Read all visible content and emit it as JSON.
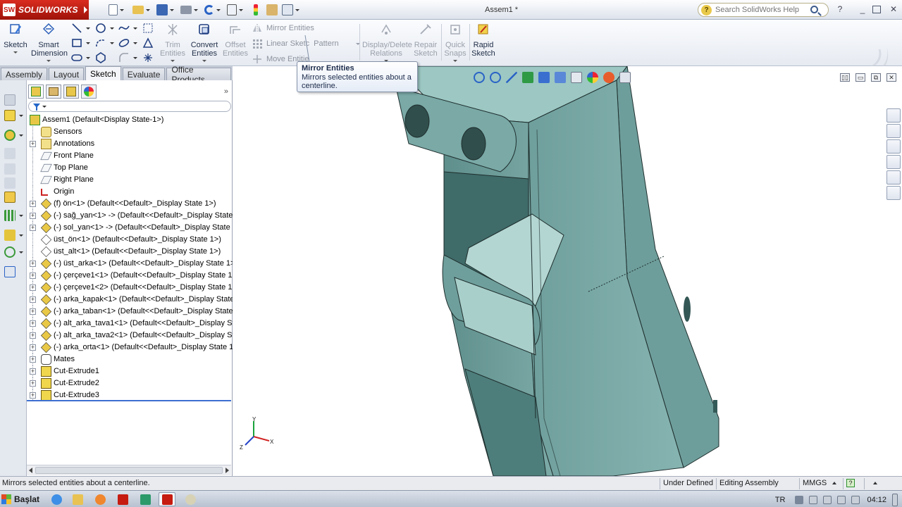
{
  "app": {
    "brand": "SOLIDWORKS",
    "document_title": "Assem1 *"
  },
  "search": {
    "placeholder": "Search SolidWorks Help"
  },
  "commands": {
    "sketch": "Sketch",
    "smart_dimension_1": "Smart",
    "smart_dimension_2": "Dimension",
    "trim_1": "Trim",
    "trim_2": "Entities",
    "convert_1": "Convert",
    "convert_2": "Entities",
    "offset_1": "Offset",
    "offset_2": "Entities",
    "mirror": "Mirror Entities",
    "linear_pattern_1": "Linear Sketc",
    "linear_pattern_2": "Pattern",
    "move": "Move Entitie",
    "display_delete_1": "Display/Delete",
    "display_delete_2": "Relations",
    "repair_1": "Repair",
    "repair_2": "Sketch",
    "quick_snaps_1": "Quick",
    "quick_snaps_2": "Snaps",
    "rapid_sketch_1": "Rapid",
    "rapid_sketch_2": "Sketch"
  },
  "tabs": [
    {
      "label": "Assembly"
    },
    {
      "label": "Layout"
    },
    {
      "label": "Sketch"
    },
    {
      "label": "Evaluate"
    },
    {
      "label": "Office Products"
    }
  ],
  "active_tab": "Sketch",
  "tooltip": {
    "title": "Mirror Entities",
    "line1": "Mirrors selected entities about a",
    "line2": "centerline."
  },
  "tree": [
    {
      "label": "Assem1  (Default<Display State-1>)",
      "icon": "assembly-icon",
      "expand": "",
      "indent": 0
    },
    {
      "label": "Sensors",
      "icon": "sensor-icon",
      "expand": "",
      "indent": 1
    },
    {
      "label": "Annotations",
      "icon": "annotation-icon",
      "expand": "+",
      "indent": 1
    },
    {
      "label": "Front Plane",
      "icon": "plane-icon",
      "expand": "",
      "indent": 1
    },
    {
      "label": "Top Plane",
      "icon": "plane-icon",
      "expand": "",
      "indent": 1
    },
    {
      "label": "Right Plane",
      "icon": "plane-icon",
      "expand": "",
      "indent": 1
    },
    {
      "label": "Origin",
      "icon": "origin-icon",
      "expand": "",
      "indent": 1
    },
    {
      "label": "(f) ön<1> (Default<<Default>_Display State 1>)",
      "icon": "part-icon",
      "expand": "+",
      "indent": 1
    },
    {
      "label": "(-) sağ_yan<1> -> (Default<<Default>_Display State 1",
      "icon": "part-icon",
      "expand": "+",
      "indent": 1
    },
    {
      "label": "(-) sol_yan<1> -> (Default<<Default>_Display State 1",
      "icon": "part-icon",
      "expand": "+",
      "indent": 1
    },
    {
      "label": "üst_ön<1> (Default<<Default>_Display State 1>)",
      "icon": "part-outline-icon",
      "expand": "",
      "indent": 1
    },
    {
      "label": "üst_alt<1> (Default<<Default>_Display State 1>)",
      "icon": "part-outline-icon",
      "expand": "",
      "indent": 1
    },
    {
      "label": "(-) üst_arka<1> (Default<<Default>_Display State 1>)",
      "icon": "part-icon",
      "expand": "+",
      "indent": 1
    },
    {
      "label": "(-) çerçeve1<1> (Default<<Default>_Display State 1>",
      "icon": "part-icon",
      "expand": "+",
      "indent": 1
    },
    {
      "label": "(-) çerçeve1<2> (Default<<Default>_Display State 1>",
      "icon": "part-icon",
      "expand": "+",
      "indent": 1
    },
    {
      "label": "(-) arka_kapak<1> (Default<<Default>_Display State 1",
      "icon": "part-icon",
      "expand": "+",
      "indent": 1
    },
    {
      "label": "(-) arka_taban<1> (Default<<Default>_Display State 1",
      "icon": "part-icon",
      "expand": "+",
      "indent": 1
    },
    {
      "label": "(-) alt_arka_tava1<1> (Default<<Default>_Display Sta",
      "icon": "part-icon",
      "expand": "+",
      "indent": 1
    },
    {
      "label": "(-) alt_arka_tava2<1> (Default<<Default>_Display Sta",
      "icon": "part-icon",
      "expand": "+",
      "indent": 1
    },
    {
      "label": "(-) arka_orta<1> (Default<<Default>_Display State 1>",
      "icon": "part-icon",
      "expand": "+",
      "indent": 1
    },
    {
      "label": "Mates",
      "icon": "mates-icon",
      "expand": "+",
      "indent": 1
    },
    {
      "label": "Cut-Extrude1",
      "icon": "cut-extrude-icon",
      "expand": "+",
      "indent": 1
    },
    {
      "label": "Cut-Extrude2",
      "icon": "cut-extrude-icon",
      "expand": "+",
      "indent": 1
    },
    {
      "label": "Cut-Extrude3",
      "icon": "cut-extrude-icon",
      "expand": "+",
      "indent": 1
    }
  ],
  "triad": {
    "x": "X",
    "y": "Y",
    "z": "Z"
  },
  "status": {
    "message": "Mirrors selected entities about a centerline.",
    "definition": "Under Defined",
    "mode": "Editing Assembly",
    "units": "MMGS"
  },
  "taskbar": {
    "start": "Başlat",
    "language": "TR",
    "clock": "04:12"
  },
  "colors": {
    "model_face": "#7aa9a6",
    "model_face_light": "#9cc7c3",
    "model_face_dark": "#4f7f7c",
    "brand_red": "#c61b10"
  }
}
